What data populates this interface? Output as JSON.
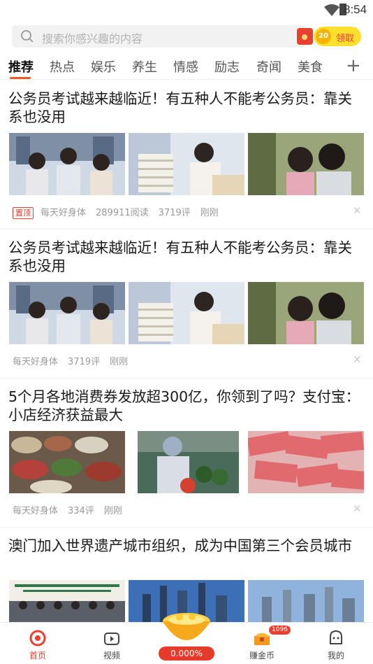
{
  "status_bar": {
    "time": "8:54"
  },
  "search": {
    "placeholder": "搜索你感兴趣的内容",
    "claim_badge": "20",
    "claim_label": "领取"
  },
  "tabs": [
    {
      "label": "推荐",
      "active": true
    },
    {
      "label": "热点"
    },
    {
      "label": "娱乐"
    },
    {
      "label": "养生"
    },
    {
      "label": "情感"
    },
    {
      "label": "励志"
    },
    {
      "label": "奇闻"
    },
    {
      "label": "美食"
    }
  ],
  "tab_more": "+",
  "articles": [
    {
      "title": "公务员考试越来越临近！有五种人不能考公务员：靠关系也没用",
      "pin": "置顶",
      "source": "每天好身体",
      "reads": "289911阅读",
      "comments": "3719评",
      "time": "刚刚"
    },
    {
      "title": "公务员考试越来越临近！有五种人不能考公务员：靠关系也没用",
      "source": "每天好身体",
      "comments": "3719评",
      "time": "刚刚"
    },
    {
      "title": "5个月各地消费券发放超300亿，你领到了吗？支付宝：小店经济获益最大",
      "source": "每天好身体",
      "comments": "334评",
      "time": "刚刚"
    },
    {
      "title": "澳门加入世界遗产城市组织，成为中国第三个会员城市"
    }
  ],
  "bottom_nav": {
    "home": "首页",
    "video": "视频",
    "progress": "0.000%",
    "coins": "赚金币",
    "coins_badge": "1096",
    "me": "我的"
  },
  "colors": {
    "accent": "#e8412f",
    "tab_underline": "#f25a2a",
    "claim": "#ffdf2e"
  }
}
